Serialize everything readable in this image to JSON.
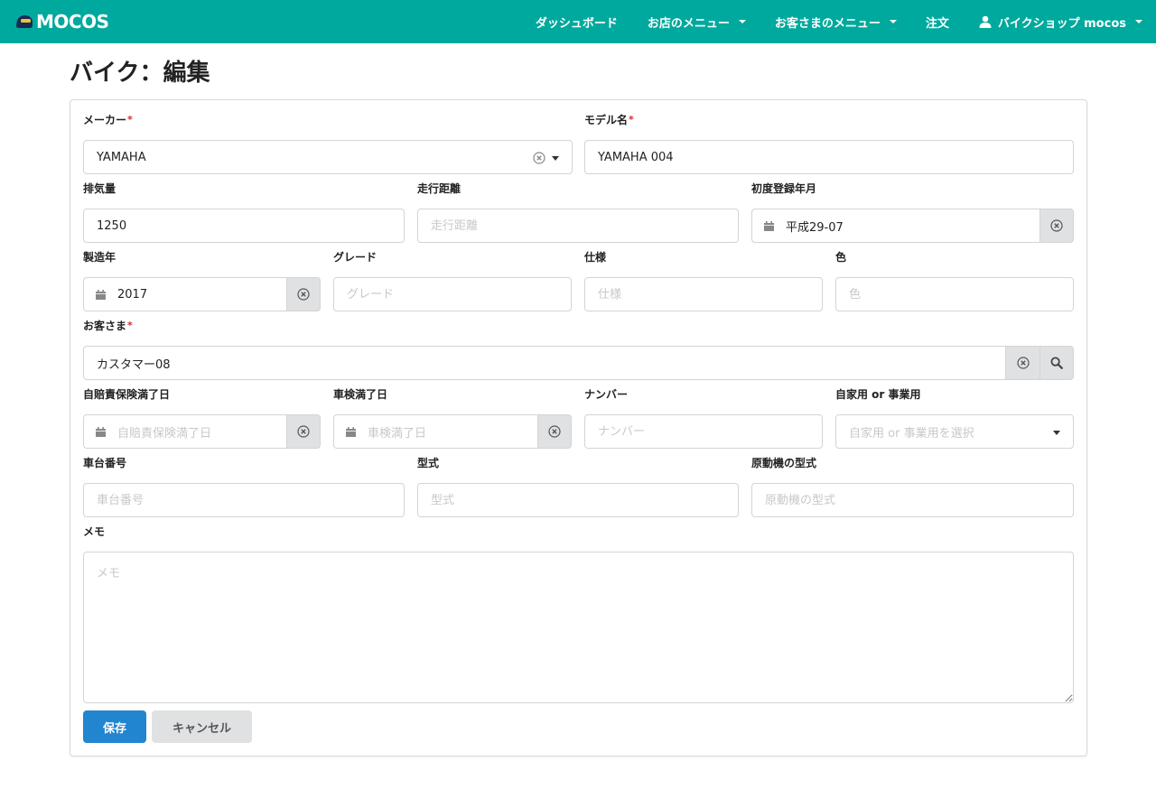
{
  "navbar": {
    "brand": "MOCOS",
    "items": [
      {
        "label": "ダッシュボード"
      },
      {
        "label": "お店のメニュー"
      },
      {
        "label": "お客さまのメニュー"
      },
      {
        "label": "注文"
      },
      {
        "label": "バイクショップ mocos"
      }
    ]
  },
  "page": {
    "title": "バイク：編集"
  },
  "form": {
    "maker": {
      "label": "メーカー",
      "value": "YAMAHA"
    },
    "model_name": {
      "label": "モデル名",
      "value": "YAMAHA 004"
    },
    "displacement": {
      "label": "排気量",
      "value": "1250"
    },
    "mileage": {
      "label": "走行距離",
      "placeholder": "走行距離"
    },
    "first_registration": {
      "label": "初度登録年月",
      "value": "平成29-07"
    },
    "year": {
      "label": "製造年",
      "value": "2017"
    },
    "grade": {
      "label": "グレード",
      "placeholder": "グレード"
    },
    "spec": {
      "label": "仕様",
      "placeholder": "仕様"
    },
    "color": {
      "label": "色",
      "placeholder": "色"
    },
    "customer": {
      "label": "お客さま",
      "value": "カスタマー08"
    },
    "insurance_expiry": {
      "label": "自賠責保険満了日",
      "placeholder": "自賠責保険満了日"
    },
    "inspection_expiry": {
      "label": "車検満了日",
      "placeholder": "車検満了日"
    },
    "number": {
      "label": "ナンバー",
      "placeholder": "ナンバー"
    },
    "usage": {
      "label": "自家用 or 事業用",
      "placeholder": "自家用 or 事業用を選択"
    },
    "frame_number": {
      "label": "車台番号",
      "placeholder": "車台番号"
    },
    "type": {
      "label": "型式",
      "placeholder": "型式"
    },
    "engine_type": {
      "label": "原動機の型式",
      "placeholder": "原動機の型式"
    },
    "memo": {
      "label": "メモ",
      "placeholder": "メモ"
    },
    "required_mark": "*"
  },
  "actions": {
    "save": "保存",
    "cancel": "キャンセル"
  },
  "colors": {
    "navbar": "#00a99d",
    "primary": "#2185d0",
    "required": "#db2828"
  },
  "icons": [
    "logo-icon",
    "caret-down-icon",
    "user-icon",
    "calendar-icon",
    "clear-icon",
    "search-icon",
    "dropdown-icon"
  ]
}
